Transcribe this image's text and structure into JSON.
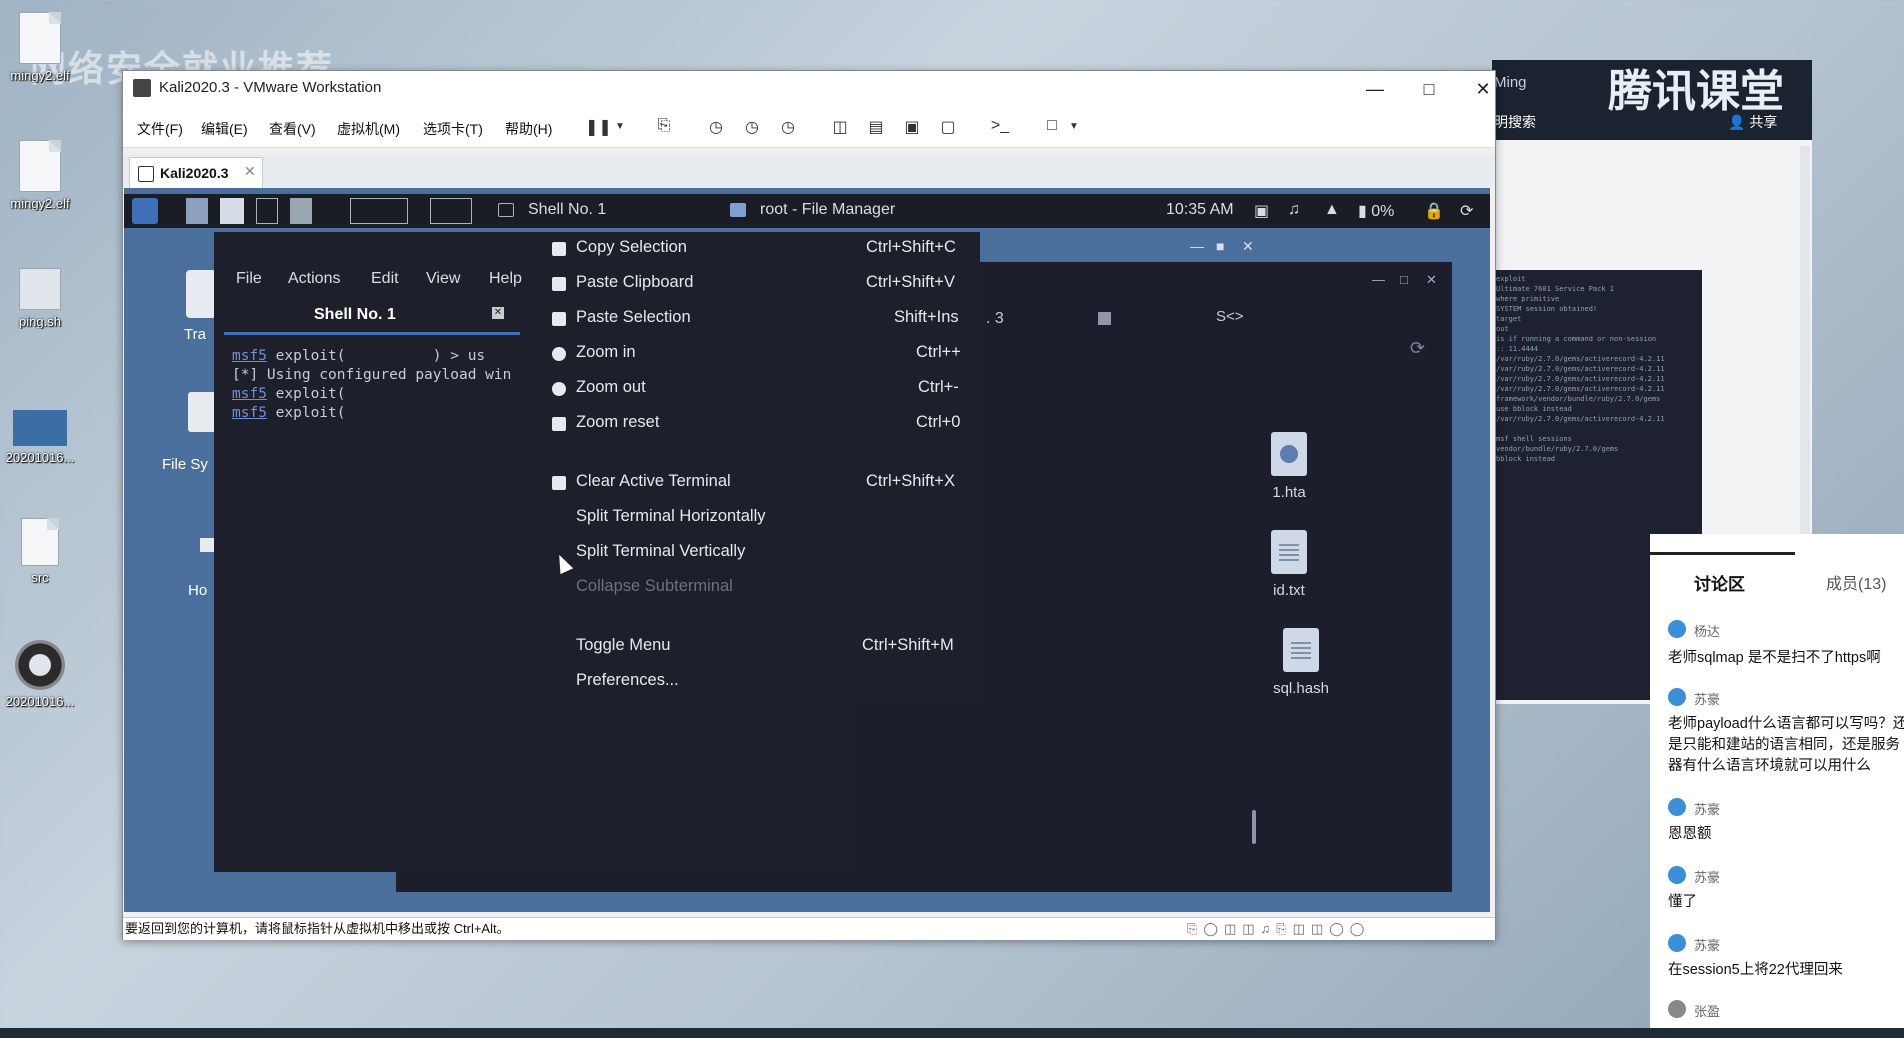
{
  "watermark": "网络安全就业推荐",
  "desktop_icons": [
    {
      "label": "mingy2.elf"
    },
    {
      "label": "mingy2.elf"
    },
    {
      "label": "ping.sh"
    },
    {
      "label": "20201016..."
    },
    {
      "label": "src"
    },
    {
      "label": "20201016..."
    }
  ],
  "tencent": {
    "brand": "腾讯课堂",
    "user": "Ming",
    "search": "明搜索",
    "share": "共享"
  },
  "discussion": {
    "title": "讨论区",
    "members": "成员(13)",
    "messages": [
      {
        "name": "杨达",
        "text": "老师sqlmap 是不是扫不了https啊"
      },
      {
        "name": "苏豪",
        "text": "老师payload什么语言都可以写吗？还是只能和建站的语言相同，还是服务器有什么语言环境就可以用什么"
      },
      {
        "name": "苏豪",
        "text": "恩恩额"
      },
      {
        "name": "苏豪",
        "text": "懂了"
      },
      {
        "name": "苏豪",
        "text": "在session5上将22代理回来"
      },
      {
        "name": "张盈",
        "text": ""
      }
    ]
  },
  "vmware": {
    "title": "Kali2020.3 - VMware Workstation",
    "menu": [
      "文件(F)",
      "编辑(E)",
      "查看(V)",
      "虚拟机(M)",
      "选项卡(T)",
      "帮助(H)"
    ],
    "tab_label": "Kali2020.3",
    "status_text": "要返回到您的计算机，请将鼠标指针从虚拟机中移出或按 Ctrl+Alt。"
  },
  "kali_panel": {
    "tasks": [
      "Shell No. 1",
      "root - File Manager"
    ],
    "time": "10:35 AM",
    "battery": "0%"
  },
  "desktop_guest_labels": [
    "Tra",
    "File Sy",
    "Ho"
  ],
  "file_manager": {
    "files": [
      {
        "name": "1.hta",
        "icon": "globe-file-icon"
      },
      {
        "name": "id.txt",
        "icon": "text-file-icon"
      },
      {
        "name": "sql.hash",
        "icon": "text-file-icon"
      }
    ],
    "partial_text": ". 3"
  },
  "terminal": {
    "menu": [
      "File",
      "Actions",
      "Edit",
      "View",
      "Help"
    ],
    "tab_label": "Shell No. 1",
    "lines": [
      {
        "prompt": "msf5",
        "text": " exploit(          ) > us"
      },
      {
        "prompt": "",
        "text": "[*] Using configured payload win"
      },
      {
        "prompt": "msf5",
        "text": " exploit("
      },
      {
        "prompt": "msf5",
        "text": " exploit("
      }
    ]
  },
  "context_menu": {
    "items": [
      {
        "label": "Copy Selection",
        "shortcut": "Ctrl+Shift+C",
        "icon": "copy-icon"
      },
      {
        "label": "Paste Clipboard",
        "shortcut": "Ctrl+Shift+V",
        "icon": "paste-icon"
      },
      {
        "label": "Paste Selection",
        "shortcut": "Shift+Ins",
        "icon": "paste-icon"
      },
      {
        "label": "Zoom in",
        "shortcut": "Ctrl++",
        "icon": "zoom-in-icon"
      },
      {
        "label": "Zoom out",
        "shortcut": "Ctrl+-",
        "icon": "zoom-out-icon"
      },
      {
        "label": "Zoom reset",
        "shortcut": "Ctrl+0",
        "icon": "zoom-reset-icon"
      },
      {
        "label": "Clear Active Terminal",
        "shortcut": "Ctrl+Shift+X",
        "icon": "clear-icon"
      },
      {
        "label": "Split Terminal Horizontally",
        "shortcut": "",
        "icon": ""
      },
      {
        "label": "Split Terminal Vertically",
        "shortcut": "",
        "icon": ""
      },
      {
        "label": "Collapse Subterminal",
        "shortcut": "",
        "icon": "",
        "disabled": true
      },
      {
        "label": "Toggle Menu",
        "shortcut": "Ctrl+Shift+M",
        "icon": ""
      },
      {
        "label": "Preferences...",
        "shortcut": "",
        "icon": ""
      }
    ]
  }
}
